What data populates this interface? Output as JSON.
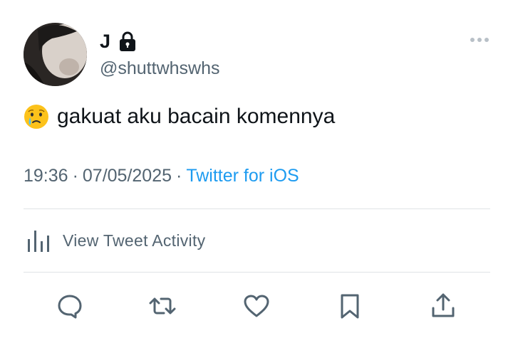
{
  "user": {
    "display_name": "J",
    "handle": "@shuttwhswhs",
    "protected_icon": "lock-icon"
  },
  "tweet": {
    "emoji_icon": "crying-face-emoji",
    "text": "gakuat aku bacain komennya"
  },
  "meta": {
    "time": "19:36",
    "separator": "·",
    "date": "07/05/2025",
    "source": "Twitter for iOS"
  },
  "activity": {
    "label": "View Tweet Activity",
    "icon": "bar-chart-icon"
  },
  "actions": [
    "reply-icon",
    "retweet-icon",
    "like-icon",
    "bookmark-icon",
    "share-icon"
  ],
  "colors": {
    "text": "#0f1419",
    "secondary": "#536471",
    "link": "#1d9bf0",
    "divider": "#dfe3e6"
  }
}
